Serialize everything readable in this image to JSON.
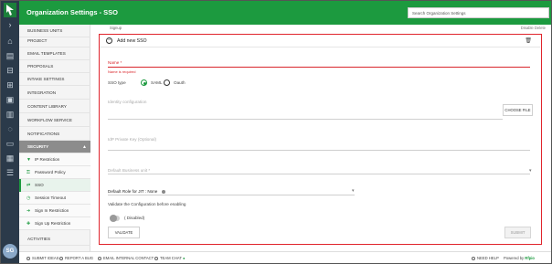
{
  "header": {
    "title": "Organization Settings - SSO",
    "search_placeholder": "Search Organization Settings"
  },
  "rail": {
    "avatar_initials": "SG"
  },
  "sidebar": {
    "items": [
      {
        "label": "BUSINESS UNITS"
      },
      {
        "label": "PROJECT"
      },
      {
        "label": "EMAIL TEMPLATES"
      },
      {
        "label": "PROPOSALS"
      },
      {
        "label": "INTAKE SETTINGS"
      },
      {
        "label": "INTEGRATION"
      },
      {
        "label": "CONTENT LIBRARY"
      },
      {
        "label": "WORKFLOW SERVICE"
      },
      {
        "label": "NOTIFICATIONS"
      }
    ],
    "section": {
      "label": "SECURITY"
    },
    "sub_items": [
      {
        "label": "IP Restriction",
        "icon": "filter-icon"
      },
      {
        "label": "Password Policy",
        "icon": "key-icon"
      },
      {
        "label": "SSO",
        "icon": "sso-icon"
      },
      {
        "label": "Session Timeout",
        "icon": "clock-icon"
      },
      {
        "label": "Sign In Restriction",
        "icon": "sign-in-icon"
      },
      {
        "label": "Sign Up Restriction",
        "icon": "sign-up-icon"
      }
    ],
    "after": [
      {
        "label": "ACTIVITIES"
      }
    ]
  },
  "topstrip": {
    "left": "Signup",
    "right": "Disable    Delete"
  },
  "panel": {
    "title": "Add new SSO",
    "name_label": "Name *",
    "name_error": "Name is required",
    "sso_type_label": "SSO type",
    "sso_options": [
      "SAML",
      "Oauth"
    ],
    "sso_selected": "SAML",
    "identity_placeholder": "Identity configuration",
    "choose_file_label": "CHOOSE FILE",
    "idp_key_placeholder": "IdP Private Key (Optional)",
    "business_unit_placeholder": "Default Business unit *",
    "default_role_label": "Default Role for JIT :",
    "default_role_value": "None",
    "validate_text": "Validate the Configuration before enabling",
    "toggle_label": "( Disabled)",
    "toggle_on": false,
    "validate_button": "VALIDATE",
    "submit_button": "SUBMIT"
  },
  "footer": {
    "items": [
      "SUBMIT IDEAS",
      "REPORT A BUG",
      "EMAIL INTERNAL CONTACT",
      "TEAM CHAT"
    ],
    "team_chat_badge": "●",
    "need_help": "NEED HELP",
    "powered_by": "Powered by",
    "brand": "Rfpio"
  },
  "colors": {
    "brand_green": "#1c9a3f",
    "highlight_red": "#e0242c",
    "rail_dark": "#2b3a4a"
  }
}
